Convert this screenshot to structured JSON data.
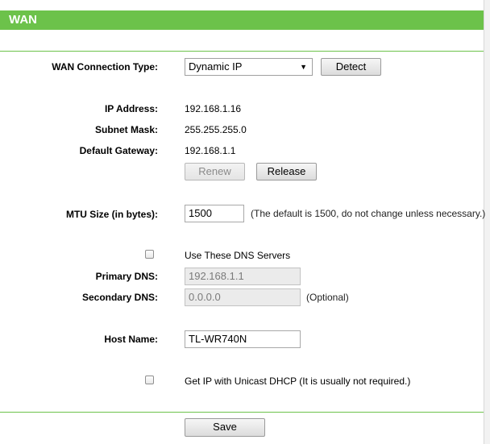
{
  "header": {
    "title": "WAN"
  },
  "wan_type": {
    "label": "WAN Connection Type:",
    "selected": "Dynamic IP",
    "detect_button": "Detect"
  },
  "status": {
    "ip_label": "IP Address:",
    "ip_value": "192.168.1.16",
    "mask_label": "Subnet Mask:",
    "mask_value": "255.255.255.0",
    "gateway_label": "Default Gateway:",
    "gateway_value": "192.168.1.1",
    "renew_button": "Renew",
    "release_button": "Release"
  },
  "mtu": {
    "label": "MTU Size (in bytes):",
    "value": "1500",
    "note": "(The default is 1500, do not change unless necessary.)"
  },
  "dns": {
    "use_label": "Use These DNS Servers",
    "primary_label": "Primary DNS:",
    "primary_value": "192.168.1.1",
    "secondary_label": "Secondary DNS:",
    "secondary_value": "0.0.0.0",
    "optional_note": "(Optional)"
  },
  "host": {
    "label": "Host Name:",
    "value": "TL-WR740N"
  },
  "unicast": {
    "label": "Get IP with Unicast DHCP (It is usually not required.)"
  },
  "save_button": "Save",
  "colors": {
    "accent": "#6cc24a"
  }
}
